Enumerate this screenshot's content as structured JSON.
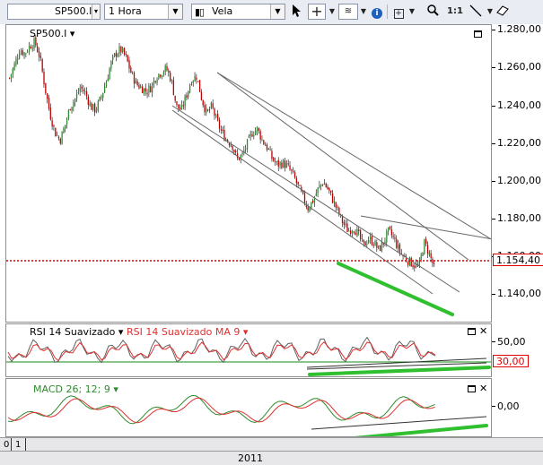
{
  "toolbar": {
    "symbol": "SP500.I",
    "timeframe": "1 Hora",
    "chart_style": "Vela",
    "zoom_label": "1:1",
    "icons": [
      "pointer-icon",
      "crosshair-icon",
      "indicators-icon",
      "info-icon",
      "add-study-icon",
      "zoom-icon",
      "line-tool-icon",
      "eraser-icon"
    ]
  },
  "price_panel": {
    "title": "SP500.I",
    "price_tag": "1.154,40",
    "axis_labels": [
      "1.280,00",
      "1.260,00",
      "1.240,00",
      "1.220,00",
      "1.200,00",
      "1.180,00",
      "1.160,00",
      "1.140,00"
    ]
  },
  "rsi_panel": {
    "title": "RSI 14 Suavizado",
    "ma_title": "RSI 14 Suavizado MA 9",
    "level_tag": "30,00",
    "axis_labels": [
      "50,00"
    ]
  },
  "macd_panel": {
    "title": "MACD 26; 12; 9",
    "axis_labels": [
      "0,00"
    ]
  },
  "x_axis": {
    "year_label": "2011",
    "left_labels": [
      "0",
      "1"
    ]
  },
  "colors": {
    "up_candle": "#2e8b2e",
    "down_candle": "#c00000",
    "level_line": "#e00000",
    "trend_highlight": "#2fbf2f",
    "rsi_line": "#606060",
    "rsi_ma": "#e03030",
    "rsi_level": "#1a8a1a",
    "macd_line": "#2e8b2e",
    "signal_line": "#e03030"
  },
  "chart_data": {
    "type": "candlestick",
    "series": [
      {
        "name": "SP500.I",
        "values": [
          1255,
          1262,
          1270,
          1268,
          1272,
          1274,
          1266,
          1250,
          1236,
          1226,
          1222,
          1230,
          1240,
          1244,
          1250,
          1247,
          1240,
          1238,
          1244,
          1252,
          1262,
          1268,
          1270,
          1266,
          1258,
          1252,
          1250,
          1248,
          1250,
          1256,
          1258,
          1260,
          1254,
          1240,
          1238,
          1246,
          1254,
          1256,
          1244,
          1236,
          1240,
          1232,
          1226,
          1222,
          1220,
          1212,
          1214,
          1220,
          1226,
          1228,
          1222,
          1218,
          1212,
          1209,
          1210,
          1208,
          1204,
          1198,
          1192,
          1186,
          1190,
          1196,
          1200,
          1196,
          1190,
          1184,
          1178,
          1174,
          1176,
          1172,
          1166,
          1170,
          1168,
          1164,
          1168,
          1174,
          1170,
          1164,
          1160,
          1158,
          1156,
          1155,
          1168,
          1162,
          1154.4
        ]
      }
    ],
    "level": 1154.4,
    "axis_range": [
      1125,
      1283
    ]
  }
}
